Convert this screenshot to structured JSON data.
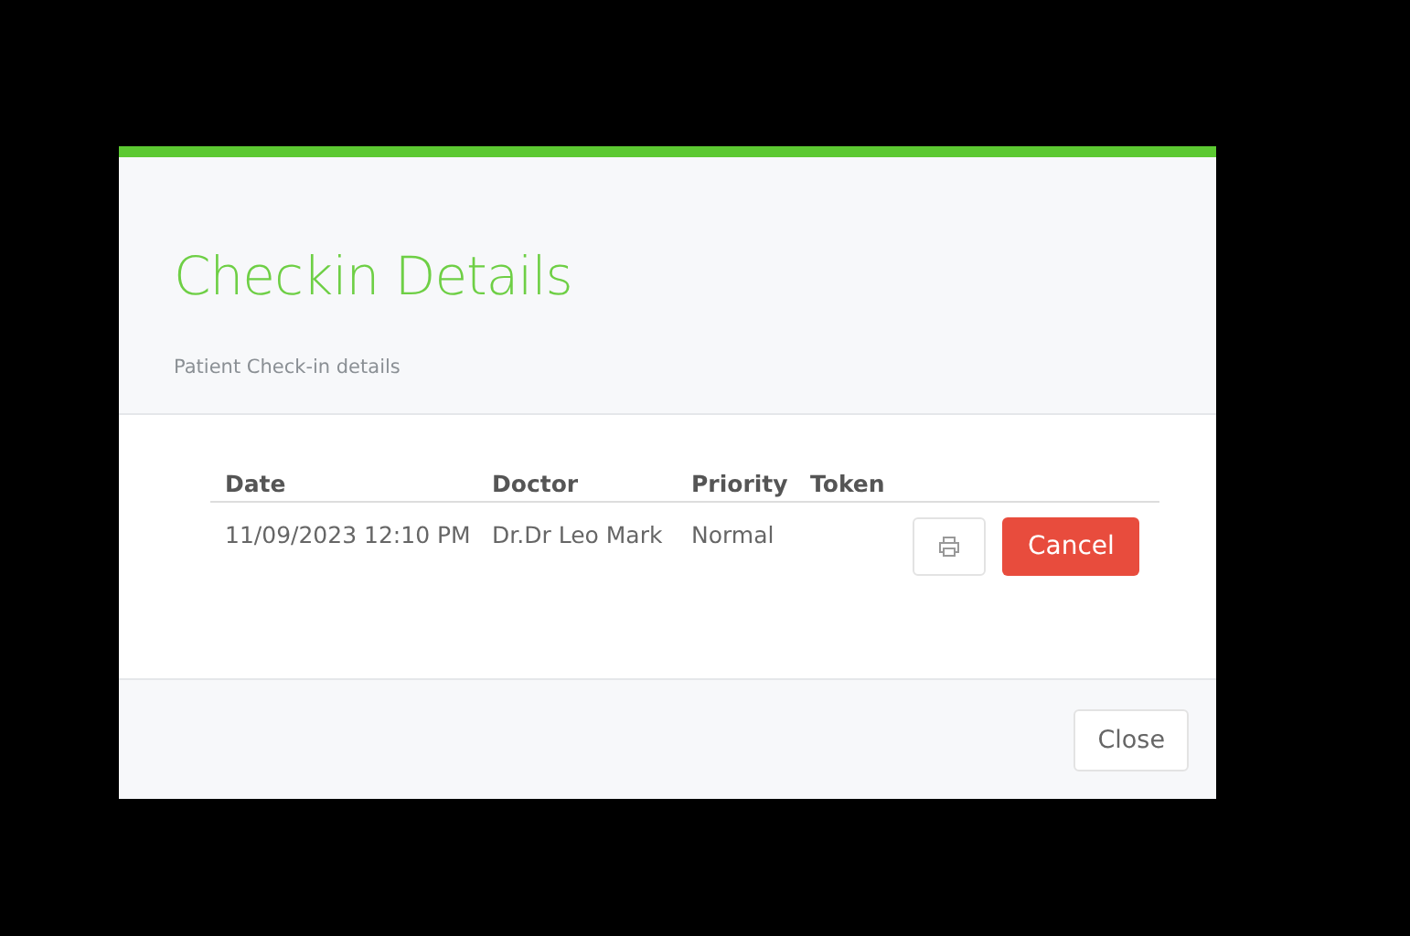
{
  "modal": {
    "title": "Checkin Details",
    "subtitle": "Patient Check-in details"
  },
  "table": {
    "columns": [
      "Date",
      "Doctor",
      "Priority",
      "Token"
    ],
    "rows": [
      {
        "date": "11/09/2023 12:10 PM",
        "doctor": "Dr.Dr Leo Mark",
        "priority": "Normal",
        "token_action": "Cancel"
      }
    ]
  },
  "footer": {
    "close": "Close"
  }
}
